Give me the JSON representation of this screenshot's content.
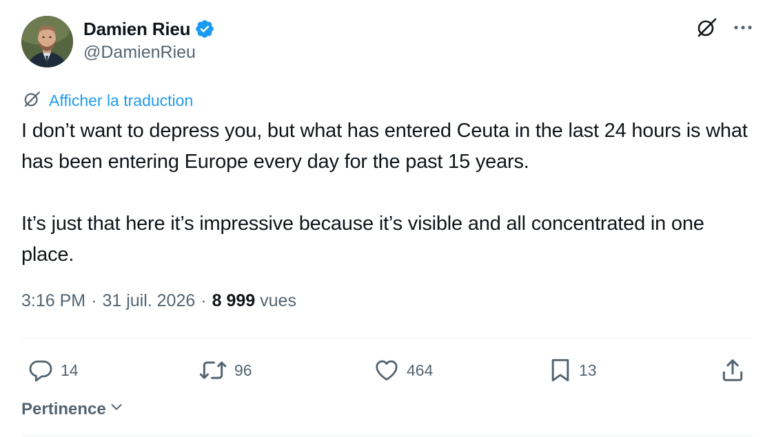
{
  "author": {
    "display_name": "Damien Rieu",
    "handle": "@DamienRieu",
    "verified": true,
    "verified_color": "#1d9bf0"
  },
  "header_icons": {
    "grok": "grok-icon",
    "more": "more-options-icon"
  },
  "translation": {
    "icon": "grok-icon",
    "label": "Afficher la traduction"
  },
  "tweet": {
    "paragraphs": [
      "I don’t want to depress you, but what has entered Ceuta in the last 24 hours is what has been entering Europe every day for the past 15 years.",
      "It’s just that here it’s impressive because it’s visible and all concentrated in one place."
    ]
  },
  "meta": {
    "time": "3:16 PM",
    "separator": "·",
    "date": "31 juil. 2026",
    "views_count": "8 999",
    "views_label": "vues"
  },
  "actions": {
    "replies": {
      "icon": "reply-icon",
      "count": "14"
    },
    "retweets": {
      "icon": "retweet-icon",
      "count": "96"
    },
    "likes": {
      "icon": "heart-icon",
      "count": "464"
    },
    "bookmarks": {
      "icon": "bookmark-icon",
      "count": "13"
    },
    "share": {
      "icon": "share-icon"
    }
  },
  "sort": {
    "label": "Pertinence",
    "icon": "chevron-down-icon"
  },
  "colors": {
    "text": "#0f1419",
    "secondary": "#536471",
    "link": "#1d9bf0",
    "divider": "#eff3f4"
  }
}
